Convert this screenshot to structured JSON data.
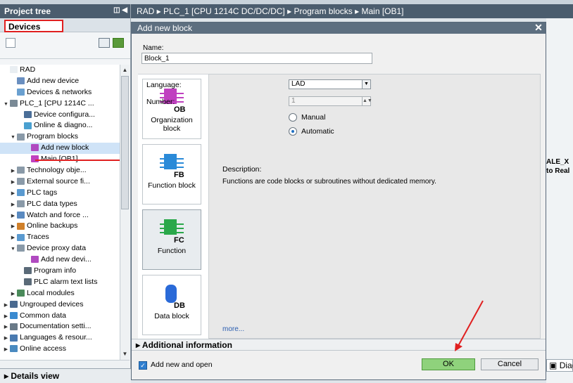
{
  "project_tree": {
    "title": "Project tree",
    "devices_tab": "Devices",
    "items": [
      {
        "label": "RAD",
        "indent": 0,
        "toggle": "",
        "icon": "project-icon",
        "color": "#e9eef2"
      },
      {
        "label": "Add new device",
        "indent": 1,
        "toggle": "",
        "icon": "add-device-icon",
        "color": "#6a8fc0"
      },
      {
        "label": "Devices & networks",
        "indent": 1,
        "toggle": "",
        "icon": "network-icon",
        "color": "#6aa0d0"
      },
      {
        "label": "PLC_1 [CPU 1214C ...",
        "indent": 0,
        "toggle": "▼",
        "icon": "plc-icon",
        "color": "#7a8a96"
      },
      {
        "label": "Device configura...",
        "indent": 2,
        "toggle": "",
        "icon": "device-config-icon",
        "color": "#4a6e98"
      },
      {
        "label": "Online & diagno...",
        "indent": 2,
        "toggle": "",
        "icon": "online-diagnostics-icon",
        "color": "#4aa0d0"
      },
      {
        "label": "Program blocks",
        "indent": 1,
        "toggle": "▼",
        "icon": "folder-icon",
        "color": "#8a9aa8"
      },
      {
        "label": "Add new block",
        "indent": 3,
        "toggle": "",
        "icon": "add-block-icon",
        "color": "#b04ac0"
      },
      {
        "label": "Main [OB1]",
        "indent": 3,
        "toggle": "",
        "icon": "ob-block-icon",
        "color": "#c040c0"
      },
      {
        "label": "Technology obje...",
        "indent": 1,
        "toggle": "▶",
        "icon": "folder-icon",
        "color": "#8a9aa8"
      },
      {
        "label": "External source fi...",
        "indent": 1,
        "toggle": "▶",
        "icon": "folder-icon",
        "color": "#8a9aa8"
      },
      {
        "label": "PLC tags",
        "indent": 1,
        "toggle": "▶",
        "icon": "folder-icon",
        "color": "#5a9ad0"
      },
      {
        "label": "PLC data types",
        "indent": 1,
        "toggle": "▶",
        "icon": "folder-icon",
        "color": "#8a9aa8"
      },
      {
        "label": "Watch and force ...",
        "indent": 1,
        "toggle": "▶",
        "icon": "folder-icon",
        "color": "#5a8ac0"
      },
      {
        "label": "Online backups",
        "indent": 1,
        "toggle": "▶",
        "icon": "folder-icon",
        "color": "#d0802a"
      },
      {
        "label": "Traces",
        "indent": 1,
        "toggle": "▶",
        "icon": "folder-icon",
        "color": "#5a9ad0"
      },
      {
        "label": "Device proxy data",
        "indent": 1,
        "toggle": "▼",
        "icon": "folder-icon",
        "color": "#8a9aa8"
      },
      {
        "label": "Add new devi...",
        "indent": 3,
        "toggle": "",
        "icon": "add-device-icon",
        "color": "#b04ac0"
      },
      {
        "label": "Program info",
        "indent": 2,
        "toggle": "",
        "icon": "program-info-icon",
        "color": "#5a6a78"
      },
      {
        "label": "PLC alarm text lists",
        "indent": 2,
        "toggle": "",
        "icon": "alarm-text-icon",
        "color": "#5a6a78"
      },
      {
        "label": "Local modules",
        "indent": 1,
        "toggle": "▶",
        "icon": "folder-icon",
        "color": "#4a8a5a"
      },
      {
        "label": "Ungrouped devices",
        "indent": 0,
        "toggle": "▶",
        "icon": "ungrouped-icon",
        "color": "#4a6a90"
      },
      {
        "label": "Common data",
        "indent": 0,
        "toggle": "▶",
        "icon": "common-data-icon",
        "color": "#3a8ad0"
      },
      {
        "label": "Documentation setti...",
        "indent": 0,
        "toggle": "▶",
        "icon": "documentation-icon",
        "color": "#6a7a88"
      },
      {
        "label": "Languages & resour...",
        "indent": 0,
        "toggle": "▶",
        "icon": "languages-icon",
        "color": "#4a7ab0"
      },
      {
        "label": "Online access",
        "indent": 0,
        "toggle": "▶",
        "icon": "online-access-icon",
        "color": "#4a8ac0"
      }
    ],
    "selected_index": 7,
    "details_view": "Details view"
  },
  "breadcrumb": "RAD ▸ PLC_1 [CPU 1214C DC/DC/DC] ▸ Program blocks ▸ Main [OB1]",
  "background": {
    "right_text_1": "ALE_X",
    "right_text_2": "to Real",
    "diag_tab": "Diag"
  },
  "dialog": {
    "title": "Add new block",
    "close": "✕",
    "name_label": "Name:",
    "name_value": "Block_1",
    "block_types": [
      {
        "label": "Organization block",
        "code": "OB",
        "color": "#c040c0"
      },
      {
        "label": "Function block",
        "code": "FB",
        "color": "#2a8ad8"
      },
      {
        "label": "Function",
        "code": "FC",
        "color": "#2aa84a"
      },
      {
        "label": "Data block",
        "code": "DB",
        "color": "#2a6ad8"
      }
    ],
    "selected_block": 2,
    "language_label": "Language:",
    "language_value": "LAD",
    "number_label": "Number:",
    "number_value": "1",
    "radio_manual": "Manual",
    "radio_automatic": "Automatic",
    "radio_selected": "automatic",
    "description_label": "Description:",
    "description_text": "Functions are code blocks or subroutines without dedicated memory.",
    "more_link": "more...",
    "additional_info": "Additional information",
    "add_and_open_label": "Add new and open",
    "add_and_open_checked": true,
    "ok_label": "OK",
    "cancel_label": "Cancel"
  },
  "colors": {
    "header": "#4b5d6e",
    "dialog_title": "#5d6f80",
    "ok_button": "#8fd27c",
    "annotation": "#e02020"
  }
}
